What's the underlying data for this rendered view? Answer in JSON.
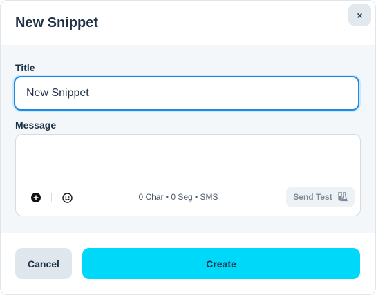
{
  "modal": {
    "title": "New Snippet",
    "close_label": "×"
  },
  "form": {
    "title_label": "Title",
    "title_value": "New Snippet",
    "message_label": "Message",
    "message_value": "",
    "counter_text": "0 Char • 0 Seg • SMS",
    "send_test_label": "Send Test"
  },
  "icons": {
    "add": "plus-circle-icon",
    "emoji": "smiley-icon",
    "send_test": "flask-icon"
  },
  "footer": {
    "cancel_label": "Cancel",
    "create_label": "Create"
  },
  "colors": {
    "accent": "#00d8fa",
    "focus": "#1a8ce3",
    "text": "#1f3147"
  }
}
